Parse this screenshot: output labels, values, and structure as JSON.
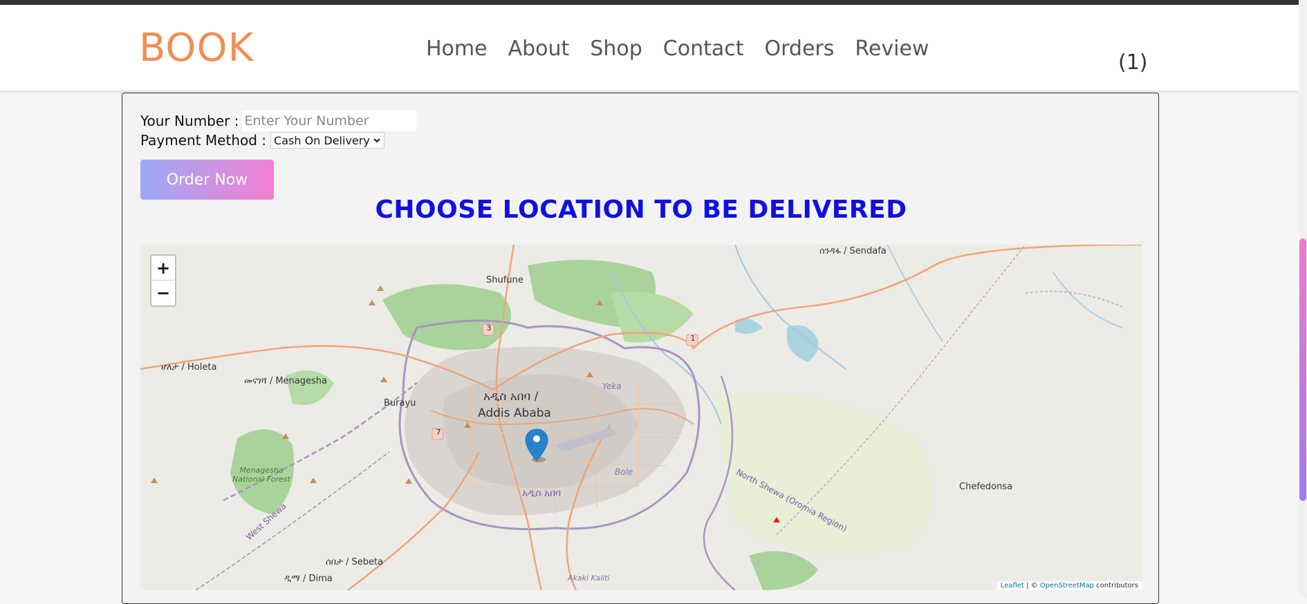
{
  "header": {
    "logo": "BOOK",
    "nav": [
      "Home",
      "About",
      "Shop",
      "Contact",
      "Orders",
      "Review"
    ],
    "cart_count": "(1)"
  },
  "form": {
    "number_label": "Your Number :",
    "number_placeholder": "Enter Your Number",
    "payment_label": "Payment Method :",
    "payment_selected": "Cash On Delivery",
    "order_button": "Order Now"
  },
  "location_heading": "CHOOSE LOCATION TO BE DELIVERED",
  "map": {
    "zoom_in": "+",
    "zoom_out": "−",
    "labels": {
      "sendafa": "ሰንዳፋ / Sendafa",
      "shufune": "Shufune",
      "holeta": "ሆለታ / Holeta",
      "menagesha": "መናገሻ / Menagesha",
      "burayu": "Burayu",
      "addis_amharic": "አዲስ አበባ /",
      "addis": "Addis Ababa",
      "yeka": "Yeka",
      "bole": "Bole",
      "addis_amharic2": "አዲስ አበባ",
      "north_shewa": "North Shewa (Oromia Region)",
      "chefedonsa": "Chefedonsa",
      "forest": "Menagesha National Forest",
      "west_shewa": "West Shewa",
      "sebeta": "ሰበታ / Sebeta",
      "dima": "ዲማ / Dima",
      "akaki": "Akaki Kaliti",
      "road3": "3",
      "road1": "1",
      "road7": "7"
    },
    "attribution_leaflet": "Leaflet",
    "attribution_sep": " | © ",
    "attribution_osm": "OpenStreetMap",
    "attribution_tail": " contributors"
  },
  "colors": {
    "logo": "#ef8f57",
    "heading": "#1010e0",
    "marker": "#2a81cb"
  }
}
